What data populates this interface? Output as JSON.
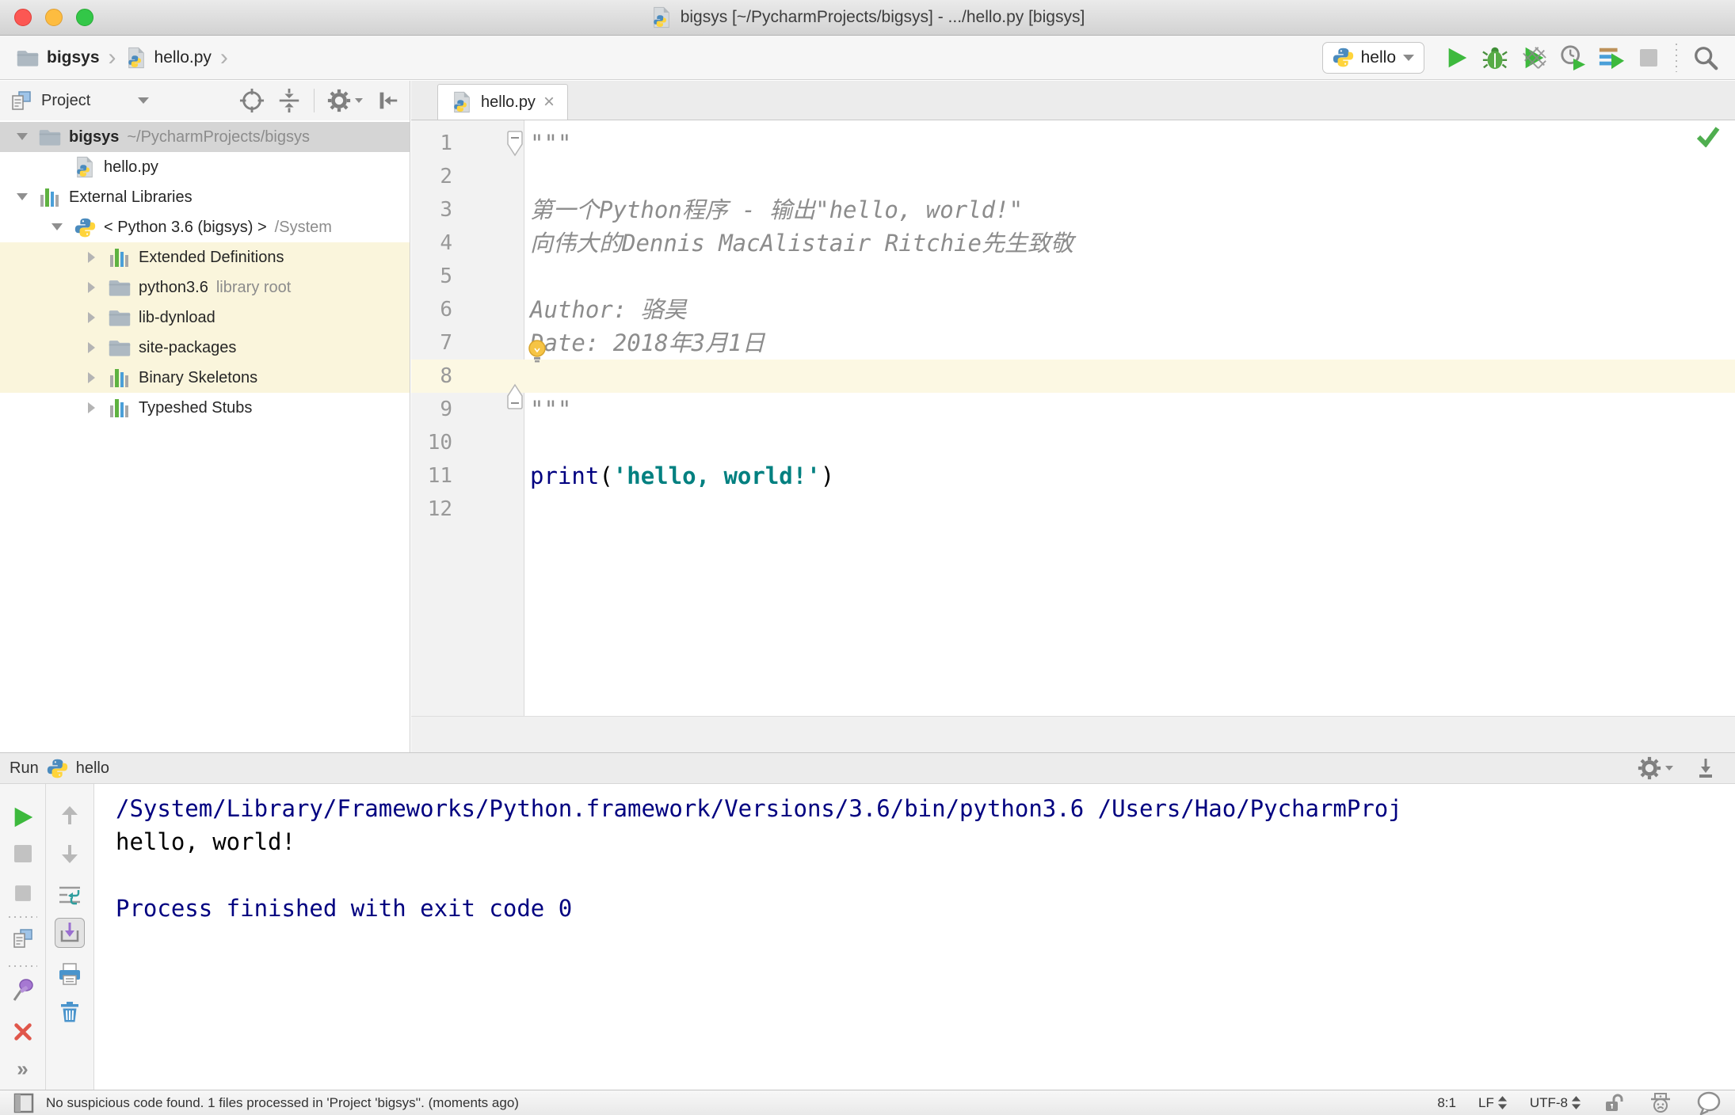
{
  "window": {
    "title": "bigsys [~/PycharmProjects/bigsys] - .../hello.py [bigsys]"
  },
  "breadcrumbs": {
    "items": [
      {
        "label": "bigsys",
        "icon": "folder-icon",
        "bold": true
      },
      {
        "label": "hello.py",
        "icon": "python-file-icon",
        "bold": false
      }
    ]
  },
  "toolbar": {
    "run_config": "hello",
    "buttons": [
      "run",
      "debug",
      "run-with-coverage",
      "profile",
      "concurrency-diagram",
      "stop",
      "search-everywhere"
    ]
  },
  "project_panel": {
    "header": {
      "title": "Project"
    },
    "tree": [
      {
        "level": 0,
        "chevron": "down",
        "icon": "folder",
        "name": "bigsys",
        "bold": true,
        "suffix": "~/PycharmProjects/bigsys",
        "bg": "selected"
      },
      {
        "level": 1,
        "chevron": null,
        "icon": "python-file",
        "name": "hello.py"
      },
      {
        "level": 0,
        "chevron": "down",
        "icon": "library",
        "name": "External Libraries"
      },
      {
        "level": 1,
        "chevron": "down",
        "icon": "python-logo",
        "name": "< Python 3.6 (bigsys) >",
        "suffix": "/System"
      },
      {
        "level": 2,
        "chevron": "right",
        "icon": "library",
        "name": "Extended Definitions",
        "bg": "cream"
      },
      {
        "level": 2,
        "chevron": "right",
        "icon": "folder",
        "name": "python3.6",
        "suffix": "library root",
        "bg": "cream"
      },
      {
        "level": 2,
        "chevron": "right",
        "icon": "folder",
        "name": "lib-dynload",
        "bg": "cream"
      },
      {
        "level": 2,
        "chevron": "right",
        "icon": "folder",
        "name": "site-packages",
        "bg": "cream"
      },
      {
        "level": 2,
        "chevron": "right",
        "icon": "library",
        "name": "Binary Skeletons",
        "bg": "cream"
      },
      {
        "level": 2,
        "chevron": "right",
        "icon": "library",
        "name": "Typeshed Stubs"
      }
    ]
  },
  "editor": {
    "tab": {
      "label": "hello.py"
    },
    "lines": [
      {
        "n": 1,
        "fold": "start",
        "tokens": [
          {
            "t": "\"\"\"",
            "c": "comment"
          }
        ]
      },
      {
        "n": 2,
        "tokens": []
      },
      {
        "n": 3,
        "tokens": [
          {
            "t": "第一个Python程序 - 输出\"hello, world!\"",
            "c": "comment"
          }
        ]
      },
      {
        "n": 4,
        "tokens": [
          {
            "t": "向伟大的Dennis MacAlistair Ritchie先生致敬",
            "c": "comment"
          }
        ]
      },
      {
        "n": 5,
        "tokens": []
      },
      {
        "n": 6,
        "tokens": [
          {
            "t": "Author: 骆昊",
            "c": "comment"
          }
        ]
      },
      {
        "n": 7,
        "bulb": true,
        "tokens": [
          {
            "t": "Date: 2018年3月1日",
            "c": "comment"
          }
        ]
      },
      {
        "n": 8,
        "caret": true,
        "tokens": []
      },
      {
        "n": 9,
        "fold": "end",
        "tokens": [
          {
            "t": "\"\"\"",
            "c": "comment"
          }
        ]
      },
      {
        "n": 10,
        "tokens": []
      },
      {
        "n": 11,
        "tokens": [
          {
            "t": "print",
            "c": "keyword"
          },
          {
            "t": "(",
            "c": "plain"
          },
          {
            "t": "'hello, world!'",
            "c": "string"
          },
          {
            "t": ")",
            "c": "plain"
          }
        ]
      },
      {
        "n": 12,
        "tokens": []
      }
    ]
  },
  "run_panel": {
    "title": "Run",
    "config": "hello",
    "console": [
      {
        "text": "/System/Library/Frameworks/Python.framework/Versions/3.6/bin/python3.6 /Users/Hao/PycharmProj",
        "c": "system"
      },
      {
        "text": "hello, world!",
        "c": "stdout"
      },
      {
        "text": "",
        "c": "stdout"
      },
      {
        "text": "Process finished with exit code 0",
        "c": "system"
      }
    ]
  },
  "status_bar": {
    "message": "No suspicious code found. 1 files processed in 'Project 'bigsys''. (moments ago)",
    "caret_position": "8:1",
    "line_separator": "LF",
    "encoding": "UTF-8"
  },
  "colors": {
    "run_green": "#3db93d",
    "keyword": "#000080",
    "string": "#008080",
    "comment": "#8c8c8c",
    "console_system": "#000080",
    "caret_line": "#fcf8e3",
    "library_highlight": "#faf5dc",
    "tree_selection": "#d5d5d5"
  }
}
